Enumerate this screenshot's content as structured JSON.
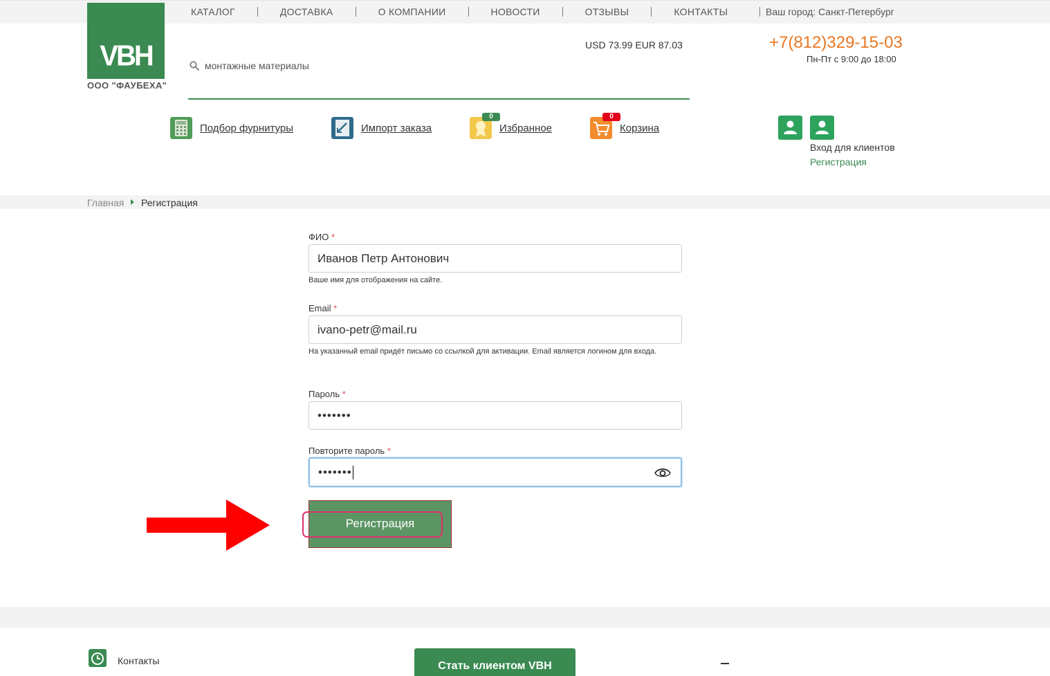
{
  "topnav": {
    "items": [
      "КАТАЛОГ",
      "ДОСТАВКА",
      "О КОМПАНИИ",
      "НОВОСТИ",
      "ОТЗЫВЫ",
      "КОНТАКТЫ"
    ],
    "city": "Ваш город: Санкт-Петербург"
  },
  "logo": {
    "text": "VBH",
    "company": "ООО \"ФАУБЕХА\""
  },
  "search": {
    "placeholder": "монтажные материалы"
  },
  "rates": "USD 73.99 EUR 87.03",
  "contact": {
    "phone": "+7(812)329-15-03",
    "hours": "Пн-Пт с 9:00 до 18:00"
  },
  "actions": {
    "fittings": "Подбор фурнитуры",
    "import": "Импорт заказа",
    "favorites": "Избранное",
    "favorites_count": "0",
    "cart": "Корзина",
    "cart_count": "0"
  },
  "account": {
    "login": "Вход для клиентов",
    "register": "Регистрация"
  },
  "breadcrumb": {
    "home": "Главная",
    "current": "Регистрация"
  },
  "form": {
    "name_label": "ФИО",
    "name_value": "Иванов Петр Антонович",
    "name_hint": "Ваше имя для отображения на сайте.",
    "email_label": "Email",
    "email_value": "ivano-petr@mail.ru",
    "email_hint": "На указанный email придёт письмо со ссылкой для активации. Email является логином для входа.",
    "password_label": "Пароль",
    "password_value": "•••••••",
    "confirm_label": "Повторите пароль",
    "confirm_value": "•••••••",
    "required_mark": "*",
    "submit": "Регистрация"
  },
  "footer": {
    "contacts": "Контакты",
    "become_client": "Стать клиентом VBH"
  },
  "colors": {
    "brand_green": "#3a8a52",
    "accent_orange": "#e87722",
    "highlight_pink": "#e0306a",
    "arrow_red": "#ff0000"
  }
}
